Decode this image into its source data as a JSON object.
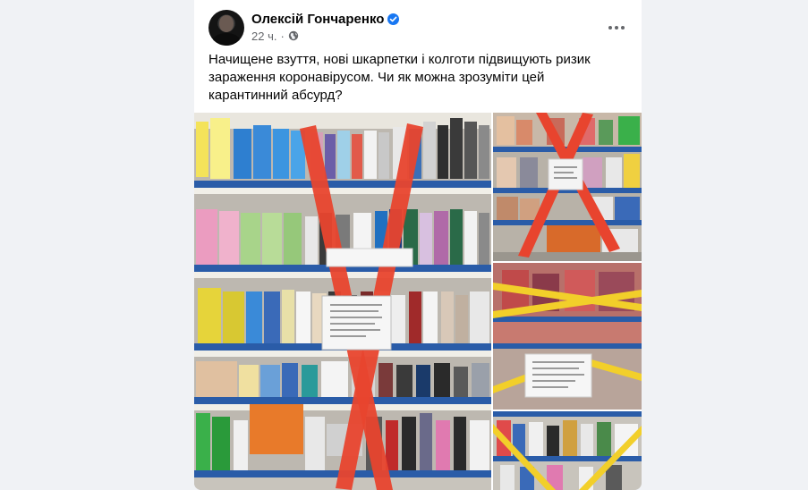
{
  "post": {
    "author": "Олексій Гончаренко",
    "time": "22 ч.",
    "text": "Начищене взуття, нові шкарпетки і колготи підвищують ризик зараження коронавірусом. Чи як можна зрозуміти цей карантинний абсурд?"
  },
  "icons": {
    "verified": "verified-badge-icon",
    "audience": "globe-icon",
    "more": "more-options-icon"
  },
  "colors": {
    "background": "#f0f2f5",
    "card": "#ffffff",
    "author": "#050505",
    "meta": "#65676b",
    "verified": "#1877f2",
    "tape_red": "#e8442e",
    "tape_yellow": "#f2cf2a"
  }
}
